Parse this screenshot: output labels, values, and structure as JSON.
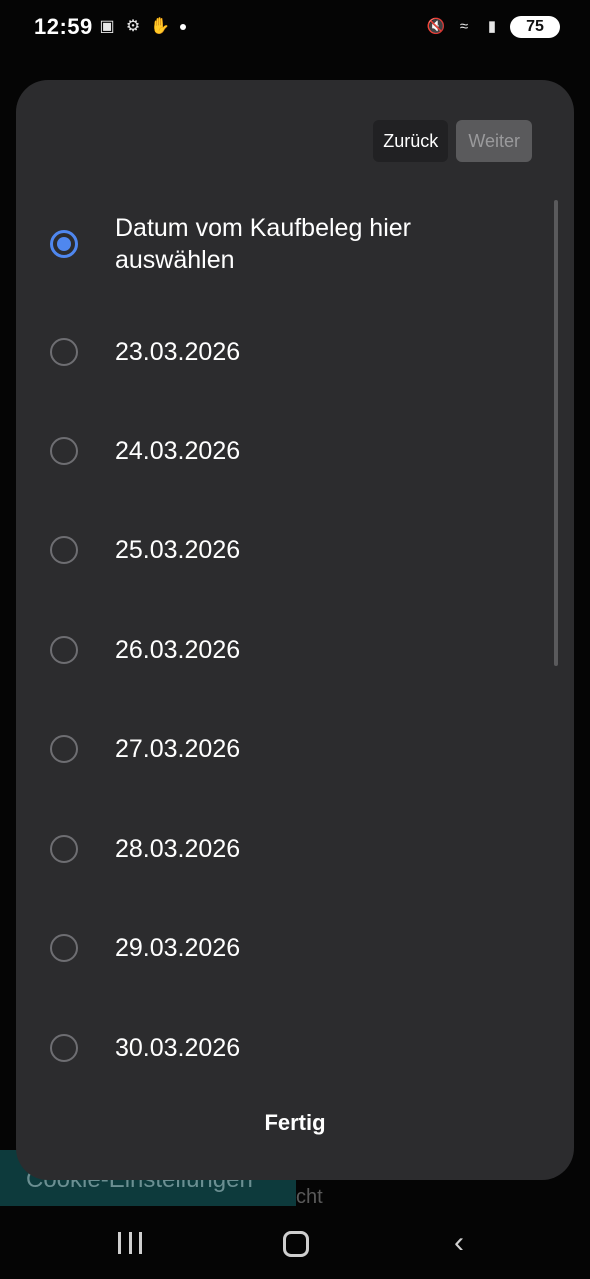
{
  "status_bar": {
    "time": "12:59",
    "left_icons": [
      "message-icon",
      "gear-notification-icon",
      "hand-icon"
    ],
    "right_icons": [
      "mute-icon",
      "wifi-icon",
      "signal-icon"
    ],
    "battery": "75"
  },
  "dialog": {
    "back_label": "Zurück",
    "next_label": "Weiter",
    "done_label": "Fertig",
    "options": [
      {
        "label": "Datum vom Kaufbeleg hier auswählen",
        "selected": true
      },
      {
        "label": "23.03.2026",
        "selected": false
      },
      {
        "label": "24.03.2026",
        "selected": false
      },
      {
        "label": "25.03.2026",
        "selected": false
      },
      {
        "label": "26.03.2026",
        "selected": false
      },
      {
        "label": "27.03.2026",
        "selected": false
      },
      {
        "label": "28.03.2026",
        "selected": false
      },
      {
        "label": "29.03.2026",
        "selected": false
      },
      {
        "label": "30.03.2026",
        "selected": false
      }
    ]
  },
  "background": {
    "cookie_label": "Cookie-Einstellungen",
    "fragment_text": "cht"
  },
  "colors": {
    "accent": "#4f87ef",
    "sheet_bg": "#2c2c2e",
    "cookie_bg": "#0d3a3c"
  }
}
